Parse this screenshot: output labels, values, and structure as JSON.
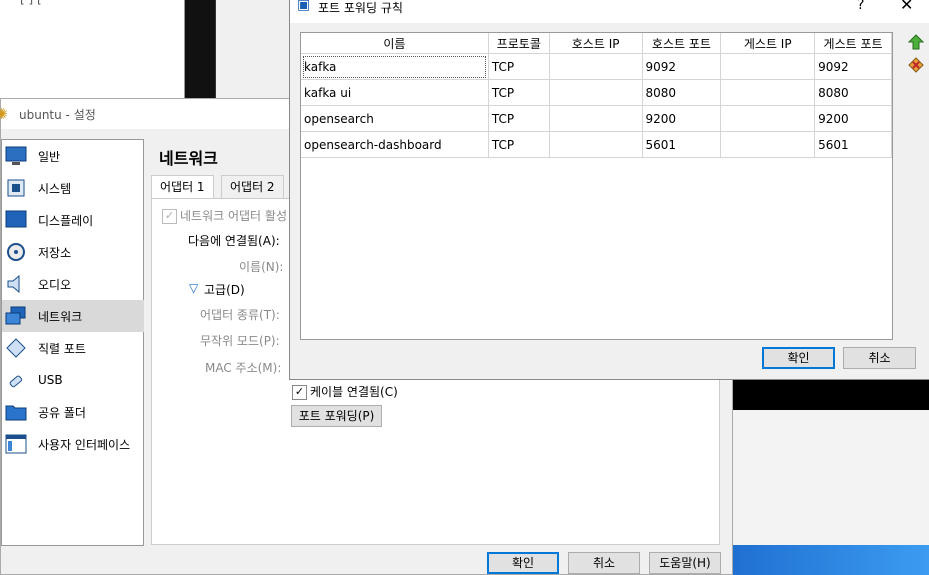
{
  "settings": {
    "title": "ubuntu - 설정",
    "section_title": "네트워크",
    "sidebar": [
      {
        "label": "일반",
        "icon": "general-icon"
      },
      {
        "label": "시스템",
        "icon": "system-icon"
      },
      {
        "label": "디스플레이",
        "icon": "display-icon"
      },
      {
        "label": "저장소",
        "icon": "storage-icon"
      },
      {
        "label": "오디오",
        "icon": "audio-icon"
      },
      {
        "label": "네트워크",
        "icon": "network-icon",
        "selected": true
      },
      {
        "label": "직렬 포트",
        "icon": "serial-port-icon"
      },
      {
        "label": "USB",
        "icon": "usb-icon"
      },
      {
        "label": "공유 폴더",
        "icon": "shared-folder-icon"
      },
      {
        "label": "사용자 인터페이스",
        "icon": "user-interface-icon"
      }
    ],
    "tabs": [
      "어댑터 1",
      "어댑터 2"
    ],
    "enable_adapter_label": "네트워크 어댑터 활성",
    "attached_to_label": "다음에 연결됨(A):",
    "name_label": "이름(N):",
    "advanced_label": "고급(D)",
    "adapter_type_label": "어댑터 종류(T):",
    "promiscuous_label": "무작위 모드(P):",
    "mac_label": "MAC 주소(M):",
    "cable_connected_label": "케이블 연결됨(C)",
    "port_forwarding_button": "포트 포워딩(P)",
    "ok_button": "확인",
    "cancel_button": "취소",
    "help_button": "도움말(H)"
  },
  "port_forwarding": {
    "title": "포트 포워딩 규칙",
    "help": "?",
    "close": "✕",
    "columns": [
      "이름",
      "프로토콜",
      "호스트 IP",
      "호스트 포트",
      "게스트 IP",
      "게스트 포트"
    ],
    "rows": [
      [
        "kafka",
        "TCP",
        "",
        "9092",
        "",
        "9092"
      ],
      [
        "kafka ui",
        "TCP",
        "",
        "8080",
        "",
        "8080"
      ],
      [
        "opensearch",
        "TCP",
        "",
        "9200",
        "",
        "9200"
      ],
      [
        "opensearch-dashboard",
        "TCP",
        "",
        "5601",
        "",
        "5601"
      ]
    ],
    "ok_button": "확인",
    "cancel_button": "취소"
  },
  "background": {
    "partial_text": "[ ]      ["
  }
}
